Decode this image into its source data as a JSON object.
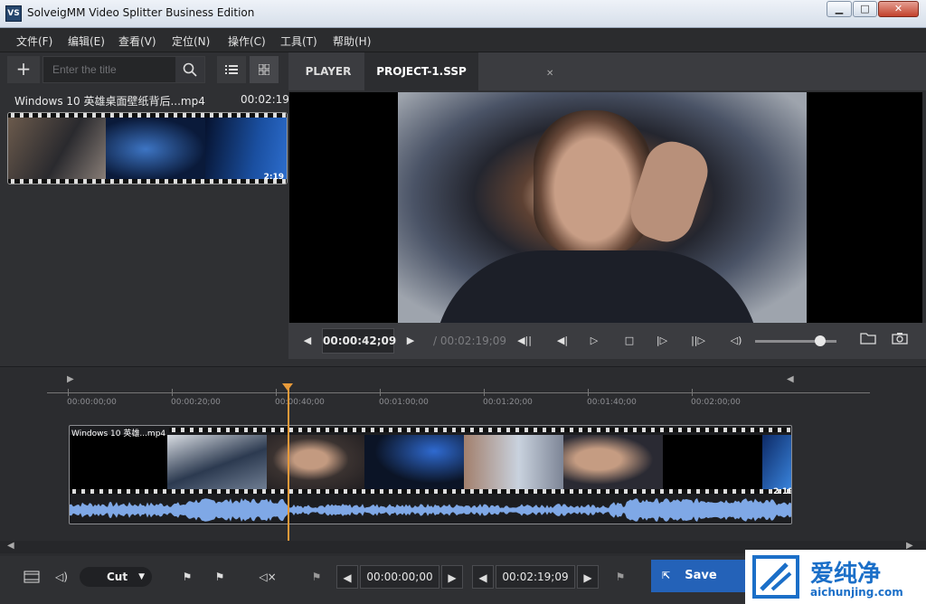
{
  "window": {
    "title": "SolveigMM Video Splitter Business Edition",
    "icon_text": "VS"
  },
  "menu": [
    "文件(F)",
    "编辑(E)",
    "查看(V)",
    "定位(N)",
    "操作(C)",
    "工具(T)",
    "帮助(H)"
  ],
  "library": {
    "search_placeholder": "Enter the title",
    "file": {
      "name": "Windows 10 英雄桌面壁纸背后...mp4",
      "duration": "00:02:19",
      "thumb_duration": "2:19"
    }
  },
  "tabs": [
    {
      "label": "PLAYER"
    },
    {
      "label": "PROJECT-1.SSP"
    }
  ],
  "player": {
    "current_time": "00:00:42;09",
    "total_time": "/ 00:02:19;09",
    "volume_level": 0.8
  },
  "timeline": {
    "ticks": [
      "00:00:00;00",
      "00:00:20;00",
      "00:00:40;00",
      "00:01:00;00",
      "00:01:20;00",
      "00:01:40;00",
      "00:02:00;00"
    ],
    "clip_name": "Windows 10 英雄...mp4",
    "clip_duration": "2:19"
  },
  "bottom": {
    "mode": "Cut",
    "range_start": "00:00:00;00",
    "range_end": "00:02:19;09",
    "save_label": "Save"
  },
  "watermark": {
    "text": "爱纯净",
    "url": "aichunjing.com"
  },
  "colors": {
    "accent": "#2462b8",
    "playhead": "#e79a3a",
    "waveform": "#7fa8e6"
  }
}
